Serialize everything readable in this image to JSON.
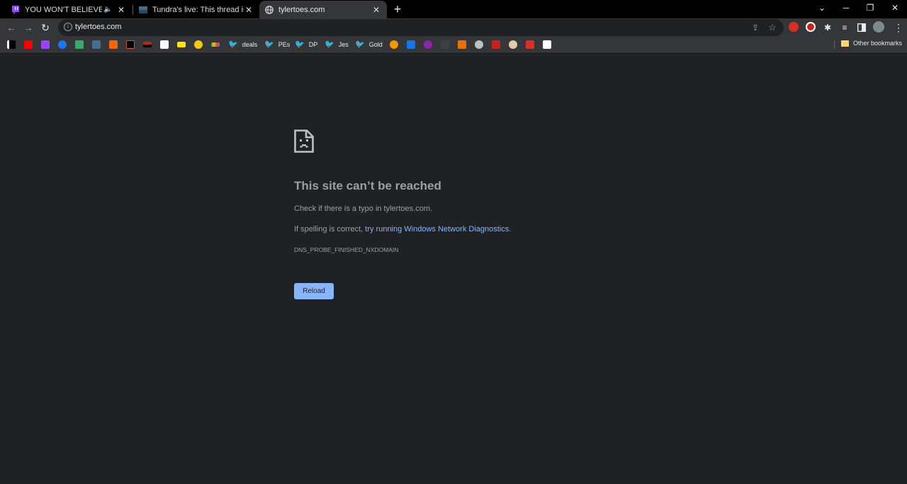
{
  "tabs": [
    {
      "title": "YOU WON'T BELIEVE HOW F",
      "icon": "twitch-icon"
    },
    {
      "title": "Tundra's live: This thread is bussi",
      "icon": "site-thumbnail-icon"
    },
    {
      "title": "tylertoes.com",
      "icon": "globe-icon"
    }
  ],
  "address_bar": {
    "url": "tylertoes.com"
  },
  "bookmarks": {
    "labels": {
      "deals": "deals",
      "pes": "PEs",
      "dp": "DP",
      "jes": "Jes",
      "gold": "Gold"
    },
    "other": "Other bookmarks"
  },
  "error_page": {
    "title": "This site can’t be reached",
    "line1": "Check if there is a typo in tylertoes.com.",
    "line2_prefix": "If spelling is correct, ",
    "line2_link": "try running Windows Network Diagnostics",
    "line2_suffix": ".",
    "code": "DNS_PROBE_FINISHED_NXDOMAIN",
    "reload_label": "Reload"
  },
  "colors": {
    "accent": "#8ab4f8",
    "page_bg": "#202124",
    "toolbar_bg": "#35363a"
  }
}
